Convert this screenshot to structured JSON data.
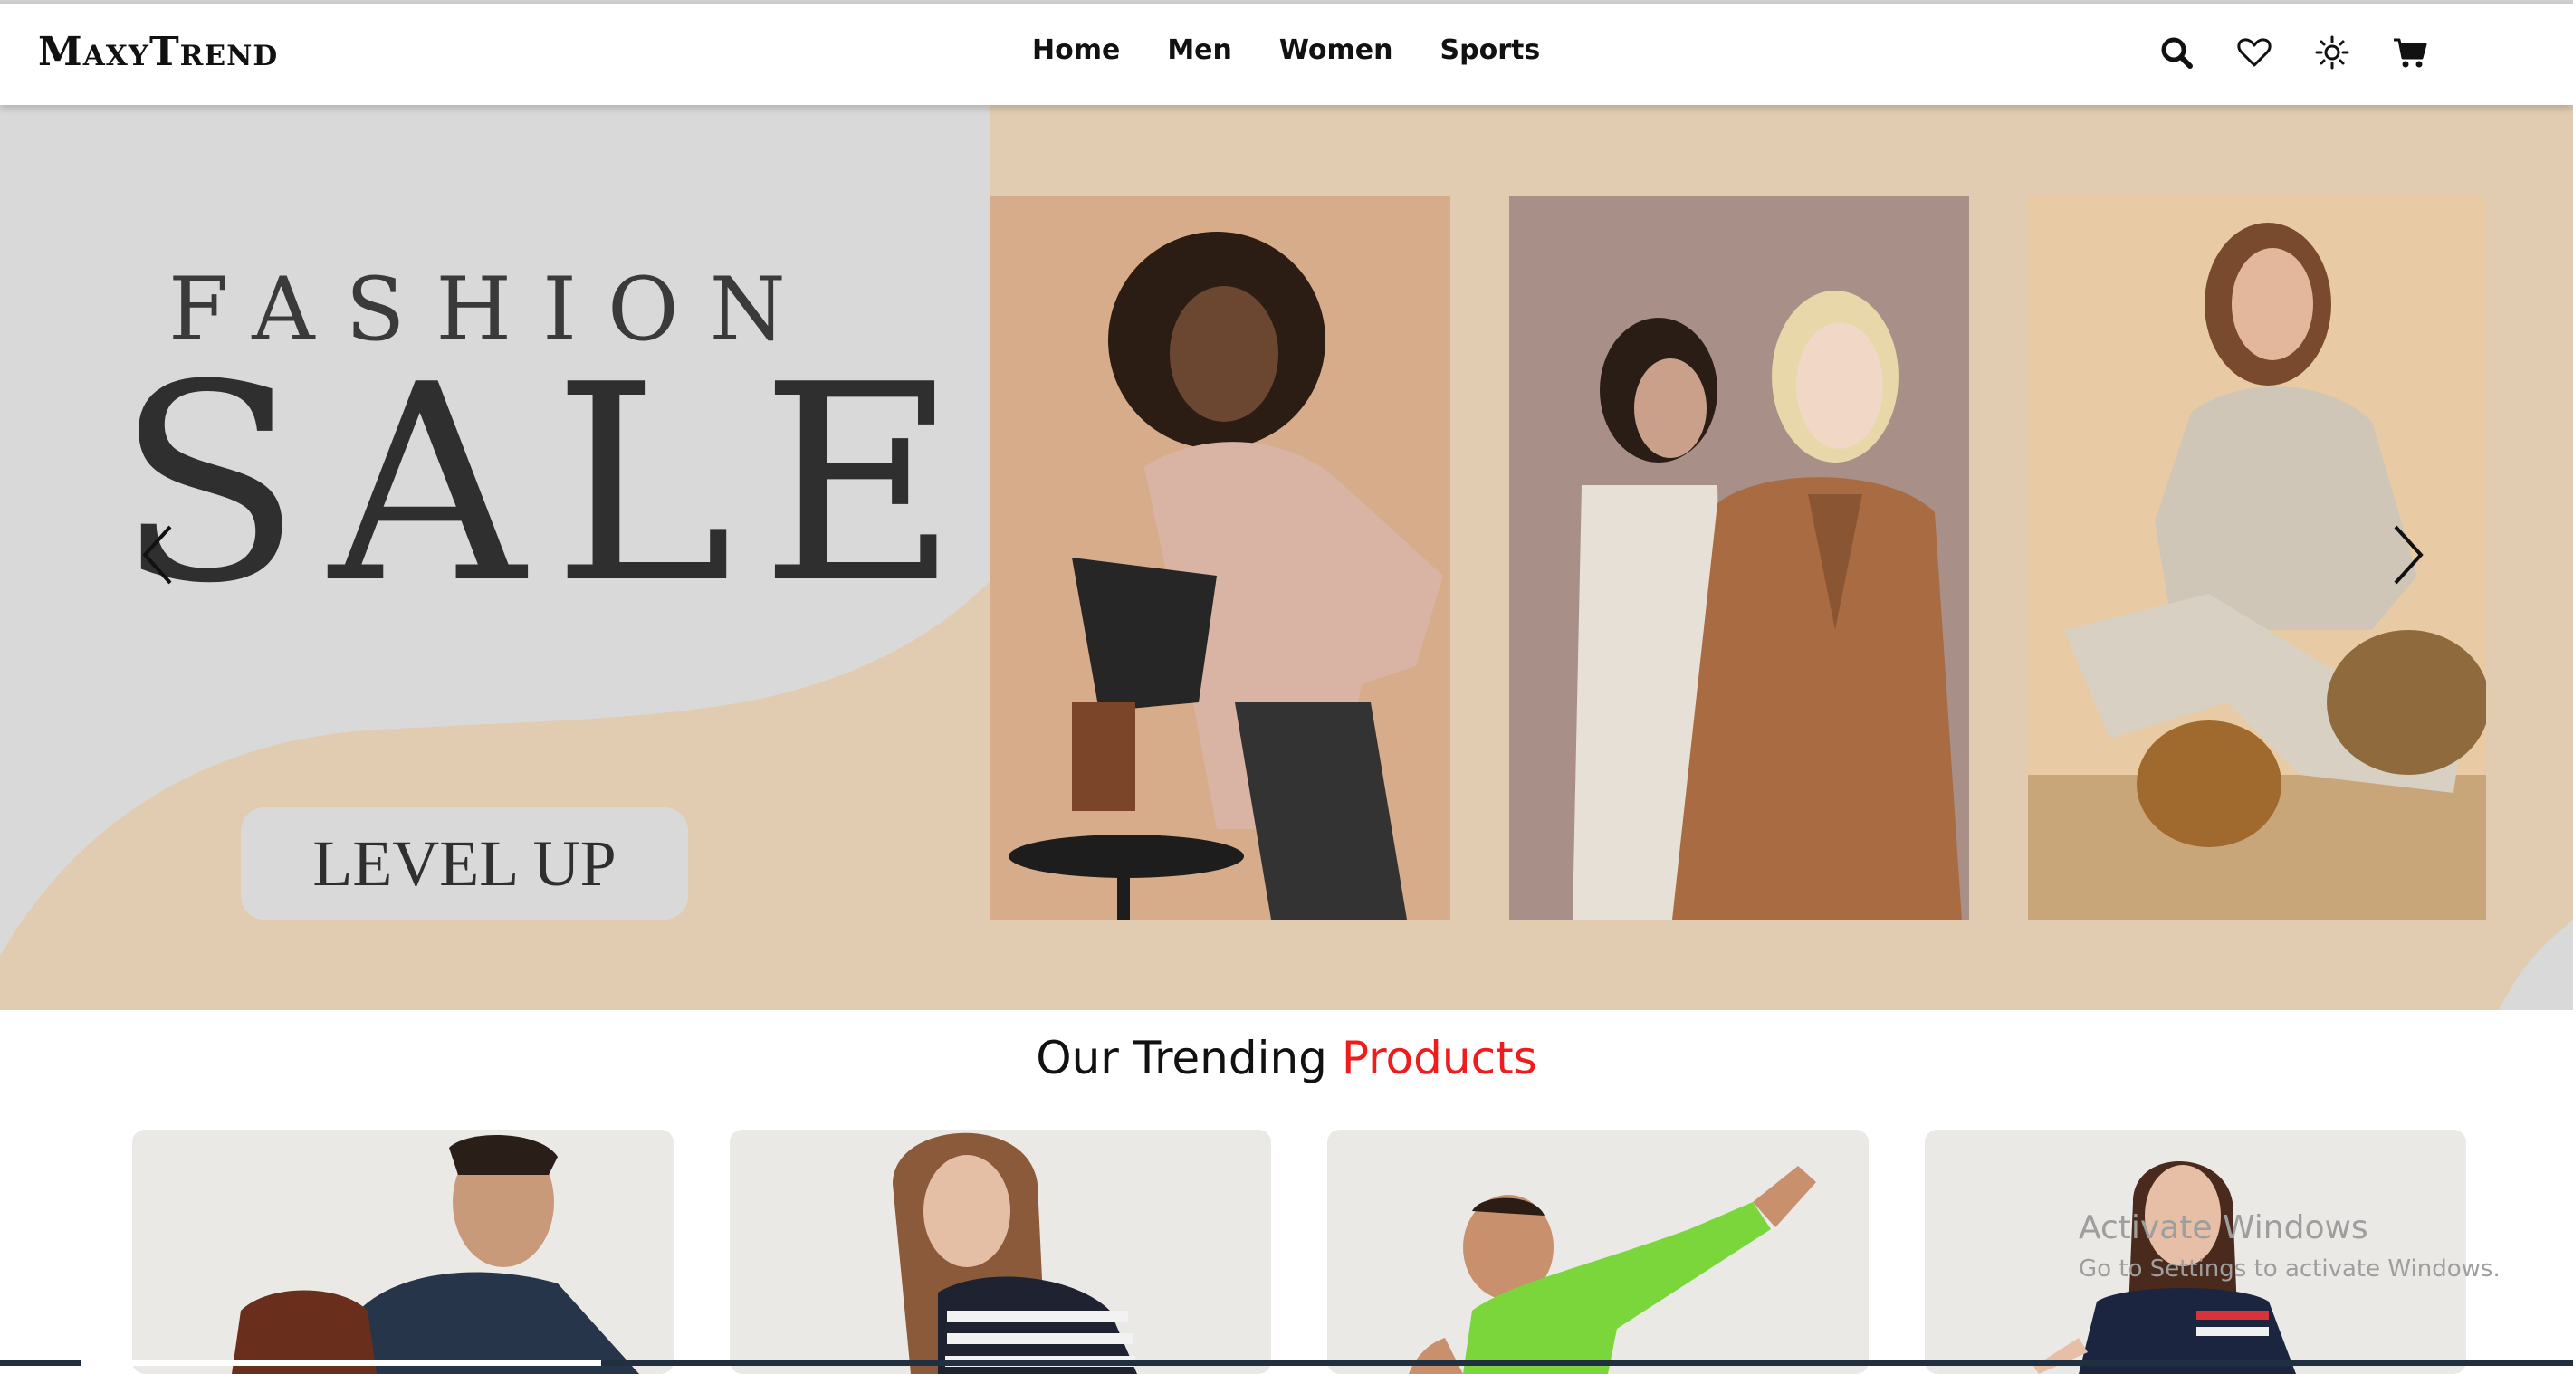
{
  "brand": {
    "name": "MaxyTrend"
  },
  "nav": {
    "links": [
      "Home",
      "Men",
      "Women",
      "Sports"
    ],
    "icons": [
      "search-icon",
      "heart-icon",
      "sun-icon",
      "cart-icon"
    ]
  },
  "hero": {
    "headline_top": "FASHION",
    "headline_main": "SALE",
    "cta_label": "LEVEL UP",
    "prev_arrow": "‹",
    "next_arrow": "›"
  },
  "trending": {
    "title_part1": "Our Trending ",
    "title_part2": "Products"
  },
  "watermark": {
    "line1": "Activate Windows",
    "line2": "Go to Settings to activate Windows."
  },
  "colors": {
    "accent": "#ee1c1c",
    "hero_bg": "#d9d9d9",
    "hero_beige": "#e2ccb1",
    "card_bg": "#ebe9e6"
  }
}
